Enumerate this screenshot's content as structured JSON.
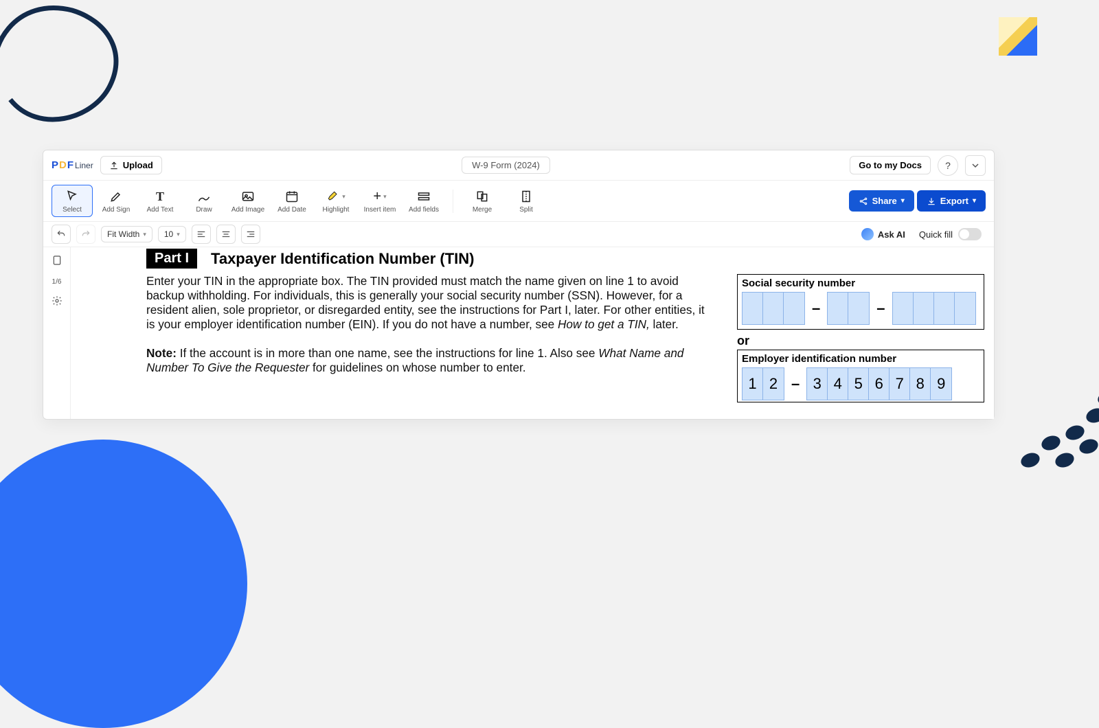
{
  "decor": {},
  "topbar": {
    "logo_main": "P",
    "logo_mid": "D",
    "logo_end": "F",
    "logo_liner": "Liner",
    "upload_label": "Upload",
    "doc_title": "W-9 Form (2024)",
    "goto_docs_label": "Go to my Docs",
    "help_label": "?"
  },
  "toolbar": {
    "tools": {
      "select": "Select",
      "add_sign": "Add Sign",
      "add_text": "Add Text",
      "draw": "Draw",
      "add_image": "Add Image",
      "add_date": "Add Date",
      "highlight": "Highlight",
      "insert_item": "Insert item",
      "add_fields": "Add fields",
      "merge": "Merge",
      "split": "Split"
    },
    "share_label": "Share",
    "export_label": "Export"
  },
  "subtoolbar": {
    "fit_label": "Fit Width",
    "zoom_label": "10",
    "askai_label": "Ask AI",
    "quickfill_label": "Quick fill"
  },
  "leftbar": {
    "page_indicator": "1/6"
  },
  "document": {
    "part_label": "Part I",
    "part_title": "Taxpayer Identification Number (TIN)",
    "para1_a": "Enter your TIN in the appropriate box. The TIN provided must match the name given on line 1 to avoid backup withholding. For individuals, this is generally your social security number (SSN). However, for a resident alien, sole proprietor, or disregarded entity, see the instructions for Part I, later. For other entities, it is your employer identification number (EIN). If you do not have a number, see ",
    "para1_i1": "How to get a TIN,",
    "para1_b": " later.",
    "note_label": "Note:",
    "para2_a": " If the account is in more than one name, see the instructions for line 1. Also see ",
    "para2_i1": "What Name and Number To Give the Requester",
    "para2_b": " for guidelines on whose number to enter.",
    "ssn_label": "Social security number",
    "or_label": "or",
    "ein_label": "Employer identification number",
    "ein_digits": [
      "1",
      "2",
      "3",
      "4",
      "5",
      "6",
      "7",
      "8",
      "9"
    ],
    "dash": "–"
  }
}
